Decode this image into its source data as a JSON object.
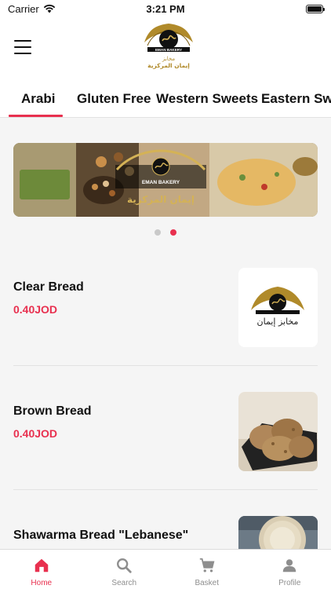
{
  "status": {
    "carrier": "Carrier",
    "time": "3:21 PM"
  },
  "header": {
    "logo_text_en": "EMAN BAKERY",
    "logo_text_ar": "إيمان المركزية"
  },
  "tabs": [
    {
      "label": "Arabi",
      "active": true
    },
    {
      "label": "Gluten Free",
      "active": false
    },
    {
      "label": "Western Sweets",
      "active": false
    },
    {
      "label": "Eastern Swe",
      "active": false
    }
  ],
  "banner": {
    "logo_text_en": "EMAN BAKERY",
    "logo_text_ar": "إيمان المركزية",
    "page_count": 2,
    "active_page": 2
  },
  "products": [
    {
      "name": "Clear Bread",
      "price": "0.40JOD",
      "image": "logo",
      "image_caption": "مخابز إيمان"
    },
    {
      "name": "Brown Bread",
      "price": "0.40JOD",
      "image": "brown-bread-photo"
    },
    {
      "name": "Shawarma Bread \"Lebanese\"",
      "price": "",
      "image": "shawarma-bread-photo"
    }
  ],
  "bottom_nav": [
    {
      "label": "Home",
      "icon": "home-icon",
      "active": true
    },
    {
      "label": "Search",
      "icon": "search-icon",
      "active": false
    },
    {
      "label": "Basket",
      "icon": "cart-icon",
      "active": false
    },
    {
      "label": "Profile",
      "icon": "person-icon",
      "active": false
    }
  ],
  "colors": {
    "accent": "#e8304f",
    "gold": "#b08a2a"
  }
}
